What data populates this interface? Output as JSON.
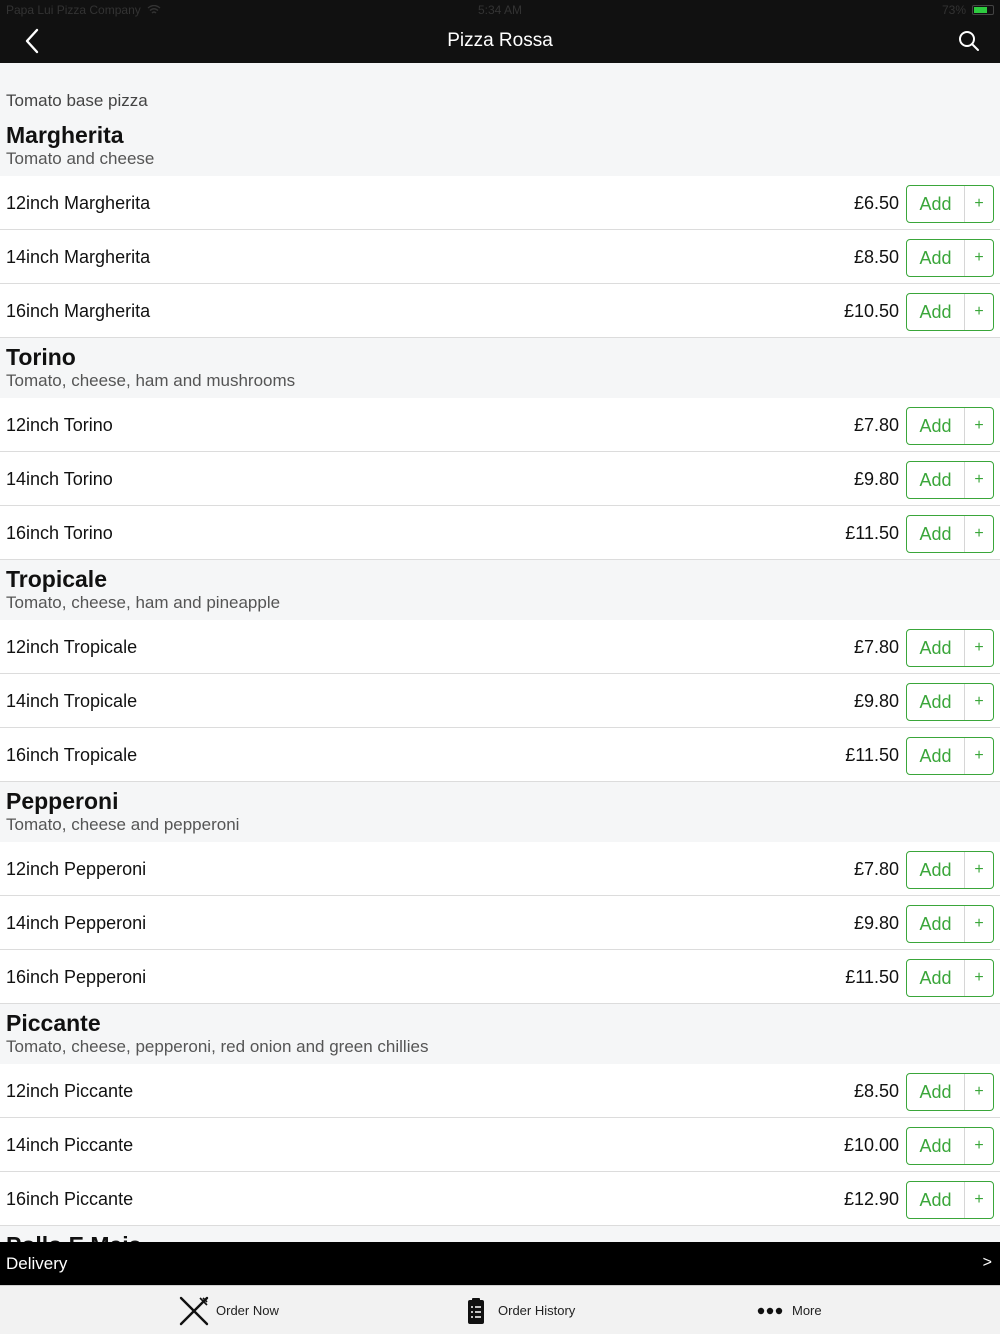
{
  "status_bar": {
    "carrier": "Papa Lui Pizza Company",
    "time": "5:34 AM",
    "battery": "73%"
  },
  "nav": {
    "title": "Pizza Rossa",
    "back_icon": "chevron-left-icon",
    "search_icon": "search-icon"
  },
  "category": {
    "label": "Tomato base pizza"
  },
  "groups": [
    {
      "title": "Margherita",
      "description": "Tomato and cheese",
      "items": [
        {
          "name": "12inch Margherita",
          "price": "£6.50"
        },
        {
          "name": "14inch Margherita",
          "price": "£8.50"
        },
        {
          "name": "16inch Margherita",
          "price": "£10.50"
        }
      ]
    },
    {
      "title": "Torino",
      "description": "Tomato, cheese, ham and mushrooms",
      "items": [
        {
          "name": "12inch Torino",
          "price": "£7.80"
        },
        {
          "name": "14inch Torino",
          "price": "£9.80"
        },
        {
          "name": "16inch Torino",
          "price": "£11.50"
        }
      ]
    },
    {
      "title": "Tropicale",
      "description": "Tomato, cheese, ham and pineapple",
      "items": [
        {
          "name": "12inch Tropicale",
          "price": "£7.80"
        },
        {
          "name": "14inch Tropicale",
          "price": "£9.80"
        },
        {
          "name": "16inch Tropicale",
          "price": "£11.50"
        }
      ]
    },
    {
      "title": "Pepperoni",
      "description": "Tomato, cheese and pepperoni",
      "items": [
        {
          "name": "12inch Pepperoni",
          "price": "£7.80"
        },
        {
          "name": "14inch Pepperoni",
          "price": "£9.80"
        },
        {
          "name": "16inch Pepperoni",
          "price": "£11.50"
        }
      ]
    },
    {
      "title": "Piccante",
      "description": "Tomato, cheese, pepperoni, red onion and green chillies",
      "items": [
        {
          "name": "12inch Piccante",
          "price": "£8.50"
        },
        {
          "name": "14inch Piccante",
          "price": "£10.00"
        },
        {
          "name": "16inch Piccante",
          "price": "£12.90"
        }
      ]
    },
    {
      "title": "Pollo E Mais",
      "description": "",
      "items": []
    }
  ],
  "add_button": {
    "label": "Add",
    "plus": "+"
  },
  "delivery": {
    "label": "Delivery",
    "chevron": ">"
  },
  "tabs": [
    {
      "label": "Order Now",
      "icon": "fork-knife-icon"
    },
    {
      "label": "Order History",
      "icon": "clipboard-icon"
    },
    {
      "label": "More",
      "icon": "more-dots-icon"
    }
  ],
  "colors": {
    "accent_green": "#3aa63a",
    "header_bg": "#111111",
    "battery_green": "#2ecc40"
  }
}
